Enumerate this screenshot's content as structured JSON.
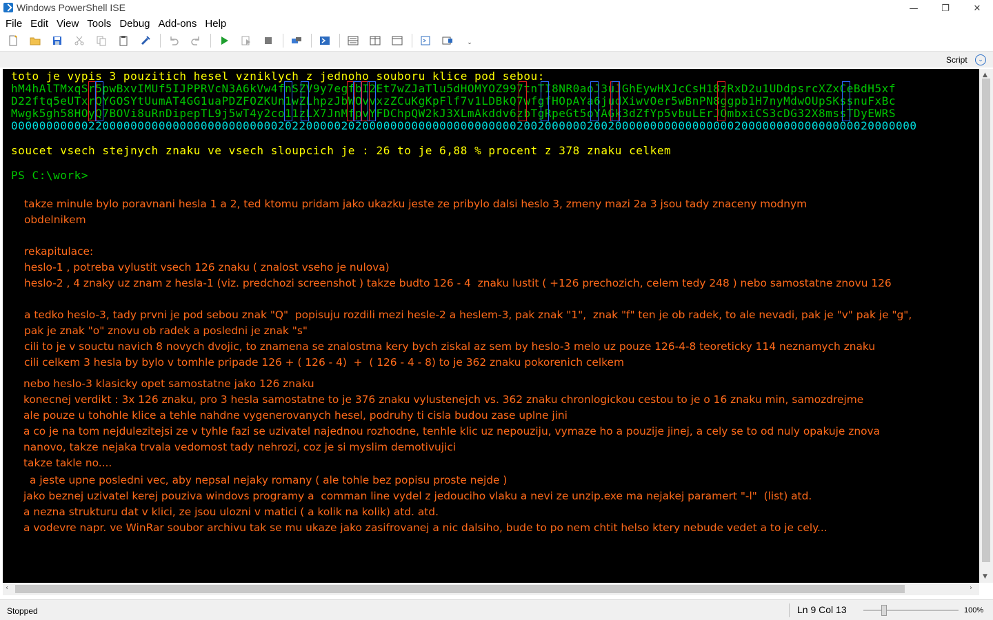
{
  "window": {
    "title": "Windows PowerShell ISE",
    "min_glyph": "—",
    "max_glyph": "❐",
    "close_glyph": "✕"
  },
  "menu": {
    "items": [
      "File",
      "Edit",
      "View",
      "Tools",
      "Debug",
      "Add-ons",
      "Help"
    ]
  },
  "toolbar": {
    "icons": [
      "new-file-icon",
      "open-folder-icon",
      "save-icon",
      "cut-icon",
      "copy-icon",
      "paste-icon",
      "clear-icon",
      "undo-icon",
      "redo-icon",
      "run-icon",
      "run-selection-icon",
      "stop-icon",
      "remote-icon",
      "powershell-icon",
      "layout-top-icon",
      "layout-right-icon",
      "layout-max-icon",
      "show-command-icon",
      "command-addon-icon",
      "overflow-icon"
    ]
  },
  "scriptbar": {
    "label": "Script",
    "chevron": "⌄"
  },
  "console": {
    "header_line": "toto je vypis 3 pouzitich hesel vzniklych z jednoho souboru klice pod sebou:",
    "key_lines": [
      "hM4hAlTMxqSr5pwBxvIMUf5IJPPRVcN3A6kVw4fnSZV9y7egfbI2Et7wZJaTlu5dHOMYOZ997tnTI8NR0aoJ3uJGhEywHXJcCsH18zRxD2u1UDdpsrcXZxCeBdH5xf",
      "D22ftq5eUTxrQYGOSYtUumAT4GG1uaPDZFOZKUn1wZLhpzJbWOvvxzZCuKgKpFlf7v1LDBkQ7wfgfHOpAYa6judXiwvOer5wBnPN8ggpb1H7nyMdwOUpSKssnuFxBc",
      "Mwgk5gh58HOyQ7BOVi8uRnDipepTL9j5wT4y2co11zLX7JnMfpvYFDChpQW2kJ3XLmAkddv6zbTgRpeGt5oYAGk3dZfYp5vbuLErJOmbxiCS3cDG32X8mssTDyEWRS"
    ],
    "diff_line": "000000000002200000000000000000000000002022000002020000000000000000000000200200000020020000000000000000020000000000000000020000000",
    "summary_line": "soucet vsech stejnych znaku ve vsech sloupcich je : 26 to je 6,88 % procent z 378 znaku celkem",
    "prompt": "PS C:\\work>"
  },
  "notes": {
    "line_1": "takze minule bylo poravnani hesla 1 a 2, ted ktomu pridam jako ukazku jeste ze pribylo dalsi heslo 3, zmeny mazi 2a 3 jsou tady znaceny modnym",
    "line_2": "obdelnikem",
    "line_3": "rekapitulace:",
    "line_4": "heslo-1 , potreba vylustit vsech 126 znaku ( znalost vseho je nulova)",
    "line_5": "heslo-2 , 4 znaky uz znam z hesla-1 (viz. predchozi screenshot ) takze budto 126 - 4  znaku lustit ( +126 prechozich, celem tedy 248 ) nebo samostatne znovu 126",
    "line_6": "a tedko heslo-3, tady prvni je pod sebou znak \"Q\"  popisuju rozdili mezi hesle-2 a heslem-3, pak znak \"1\",  znak \"f\" ten je ob radek, to ale nevadi, pak je \"v\" pak je \"g\",",
    "line_7": "pak je znak \"o\" znovu ob radek a posledni je znak \"s\"",
    "line_8": "cili to je v souctu navich 8 novych dvojic, to znamena se znalostma kery bych ziskal az sem by heslo-3 melo uz pouze 126-4-8 teoreticky 114 neznamych znaku",
    "line_9": "cili celkem 3 hesla by bylo v tomhle pripade 126 + ( 126 - 4)  +  ( 126 - 4 - 8) to je 362 znaku pokorenich celkem",
    "line_10": "nebo heslo-3 klasicky opet samostatne jako 126 znaku",
    "line_11": "konecnej verdikt : 3x 126 znaku, pro 3 hesla samostatne to je 376 znaku vylustenejch vs. 362 znaku chronlogickou cestou to je o 16 znaku min, samozdrejme",
    "line_12": "ale pouze u tohohle klice a tehle nahdne vygenerovanych hesel, podruhy ti cisla budou zase uplne jini",
    "line_13": "a co je na tom nejdulezitejsi ze v tyhle fazi se uzivatel najednou rozhodne, tenhle klic uz nepouziju, vymaze ho a pouzije jinej, a cely se to od nuly opakuje znova",
    "line_14": "nanovo, takze nejaka trvala vedomost tady nehrozi, coz je si myslim demotivujici",
    "line_15": "takze takle no....",
    "line_16": "a jeste upne posledni vec, aby nepsal nejaky romany ( ale tohle bez popisu proste nejde )",
    "line_17": "jako beznej uzivatel kerej pouziva windovs programy a  comman line vydel z jedouciho vlaku a nevi ze unzip.exe ma nejakej paramert \"-l\"  (list) atd.",
    "line_18": "a nezna strukturu dat v klici, ze jsou ulozni v matici ( a kolik na kolik) atd. atd.",
    "line_19": "a vodevre napr. ve WinRar soubor archivu tak se mu ukaze jako zasifrovanej a nic dalsiho, bude to po nem chtit helso ktery nebude vedet a to je cely..."
  },
  "status": {
    "state": "Stopped",
    "position": "Ln 9  Col 13",
    "zoom": "100%"
  },
  "colors": {
    "console_bg": "#000000",
    "header": "#ffff00",
    "keys": "#00c700",
    "diff": "#00e0e0",
    "notes": "#ff6a1a",
    "mark_red": "#e62020",
    "mark_blue": "#2a6cff"
  }
}
